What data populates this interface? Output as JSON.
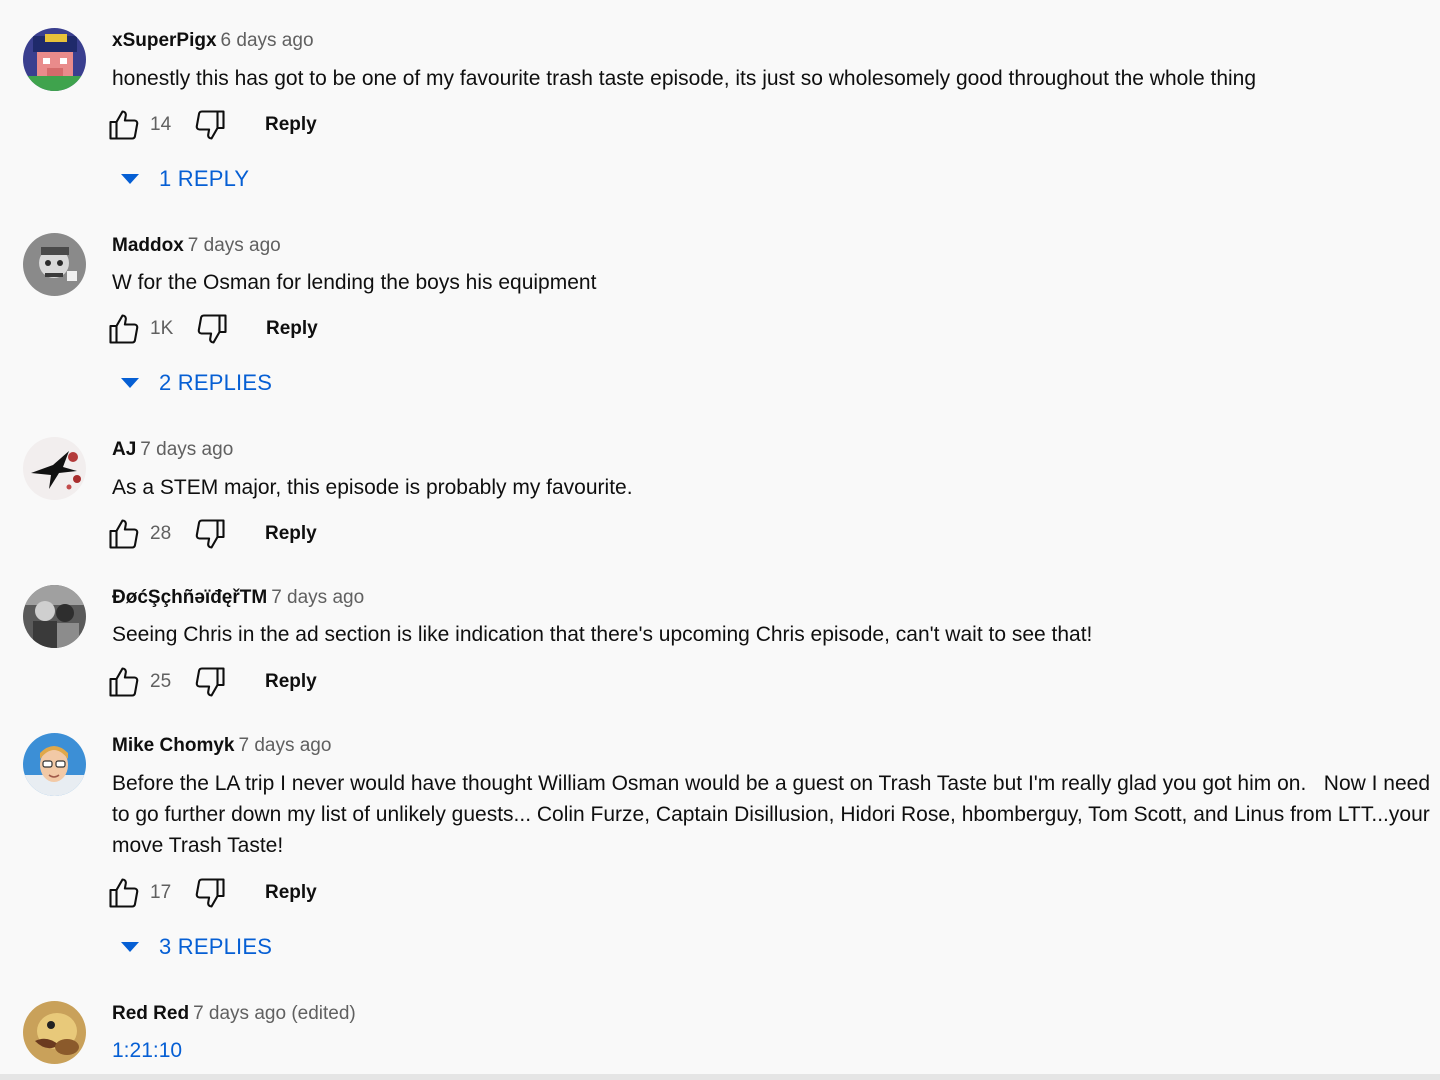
{
  "comments": [
    {
      "author": "xSuperPigx",
      "time": "6 days ago",
      "text": "honestly this has got to be one of my favourite trash taste episode, its just so wholesomely good throughout the whole thing",
      "likes": "14",
      "reply_label": "Reply",
      "replies_label": "1 REPLY",
      "avatar_icon": "minecraft-pig-avatar"
    },
    {
      "author": "Maddox",
      "time": "7 days ago",
      "text": "W for the Osman for lending the boys his equipment",
      "likes": "1K",
      "reply_label": "Reply",
      "replies_label": "2 REPLIES",
      "avatar_icon": "grey-character-avatar"
    },
    {
      "author": "AJ",
      "time": "7 days ago",
      "text": "As a STEM major, this episode is probably my favourite.",
      "likes": "28",
      "reply_label": "Reply",
      "avatar_icon": "bird-avatar"
    },
    {
      "author": "ĐøćŞçhñəïđęřTM",
      "time": "7 days ago",
      "text": "Seeing Chris in the ad section is like indication that there's upcoming Chris episode, can't wait to see that!",
      "likes": "25",
      "reply_label": "Reply",
      "avatar_icon": "bw-photo-avatar"
    },
    {
      "author": "Mike Chomyk",
      "time": "7 days ago",
      "text": "Before the LA trip I never would have thought William Osman would be a guest on Trash Taste but I'm really glad you got him on.   Now I need to go further down my list of unlikely guests... Colin Furze, Captain Disillusion, Hidori Rose, hbomberguy, Tom Scott, and Linus from LTT...your move Trash Taste!",
      "likes": "17",
      "reply_label": "Reply",
      "replies_label": "3 REPLIES",
      "avatar_icon": "cartoon-face-avatar"
    },
    {
      "author": "Red Red",
      "time": "7 days ago (edited)",
      "text": "1:21:10",
      "avatar_icon": "duck-avatar"
    }
  ],
  "colors": {
    "background": "#f9f9f9",
    "link": "#065fd4",
    "secondary_text": "#606060"
  }
}
